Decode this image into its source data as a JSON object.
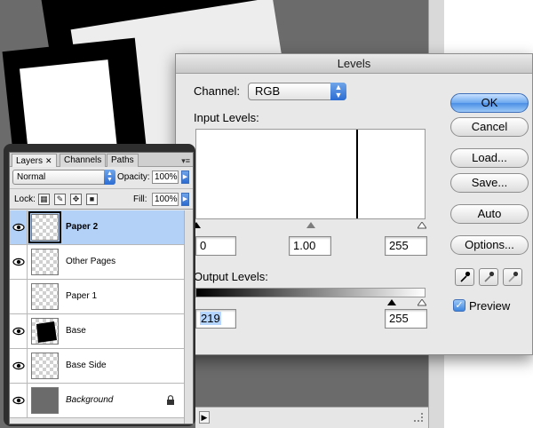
{
  "levels_dialog": {
    "title": "Levels",
    "channel_label": "Channel:",
    "channel_value": "RGB",
    "input_levels_label": "Input Levels:",
    "input_black": "0",
    "input_gamma": "1.00",
    "input_white": "255",
    "output_levels_label": "Output Levels:",
    "output_black": "219",
    "output_white": "255",
    "buttons": {
      "ok": "OK",
      "cancel": "Cancel",
      "load": "Load...",
      "save": "Save...",
      "auto": "Auto",
      "options": "Options..."
    },
    "preview_label": "Preview",
    "preview_checked": true
  },
  "layers_panel": {
    "tabs": [
      {
        "label": "Layers",
        "active": true
      },
      {
        "label": "Channels",
        "active": false
      },
      {
        "label": "Paths",
        "active": false
      }
    ],
    "blend_mode": "Normal",
    "opacity_label": "Opacity:",
    "opacity_value": "100%",
    "lock_label": "Lock:",
    "fill_label": "Fill:",
    "fill_value": "100%",
    "layers": [
      {
        "name": "Paper 2",
        "visible": true,
        "selected": true
      },
      {
        "name": "Other Pages",
        "visible": true,
        "selected": false
      },
      {
        "name": "Paper 1",
        "visible": false,
        "selected": false
      },
      {
        "name": "Base",
        "visible": true,
        "selected": false
      },
      {
        "name": "Base Side",
        "visible": true,
        "selected": false
      },
      {
        "name": "Background",
        "visible": true,
        "selected": false,
        "locked": true
      }
    ]
  },
  "icons": {
    "visibility": "eye-icon",
    "lock": "lock-icon",
    "eyedropper": "eyedropper-icon",
    "panel_menu": "panel-menu-icon"
  },
  "colors": {
    "accent": "#4b8fe6",
    "selection": "#b3d1f7",
    "canvas_gray": "#6b6b6b"
  }
}
